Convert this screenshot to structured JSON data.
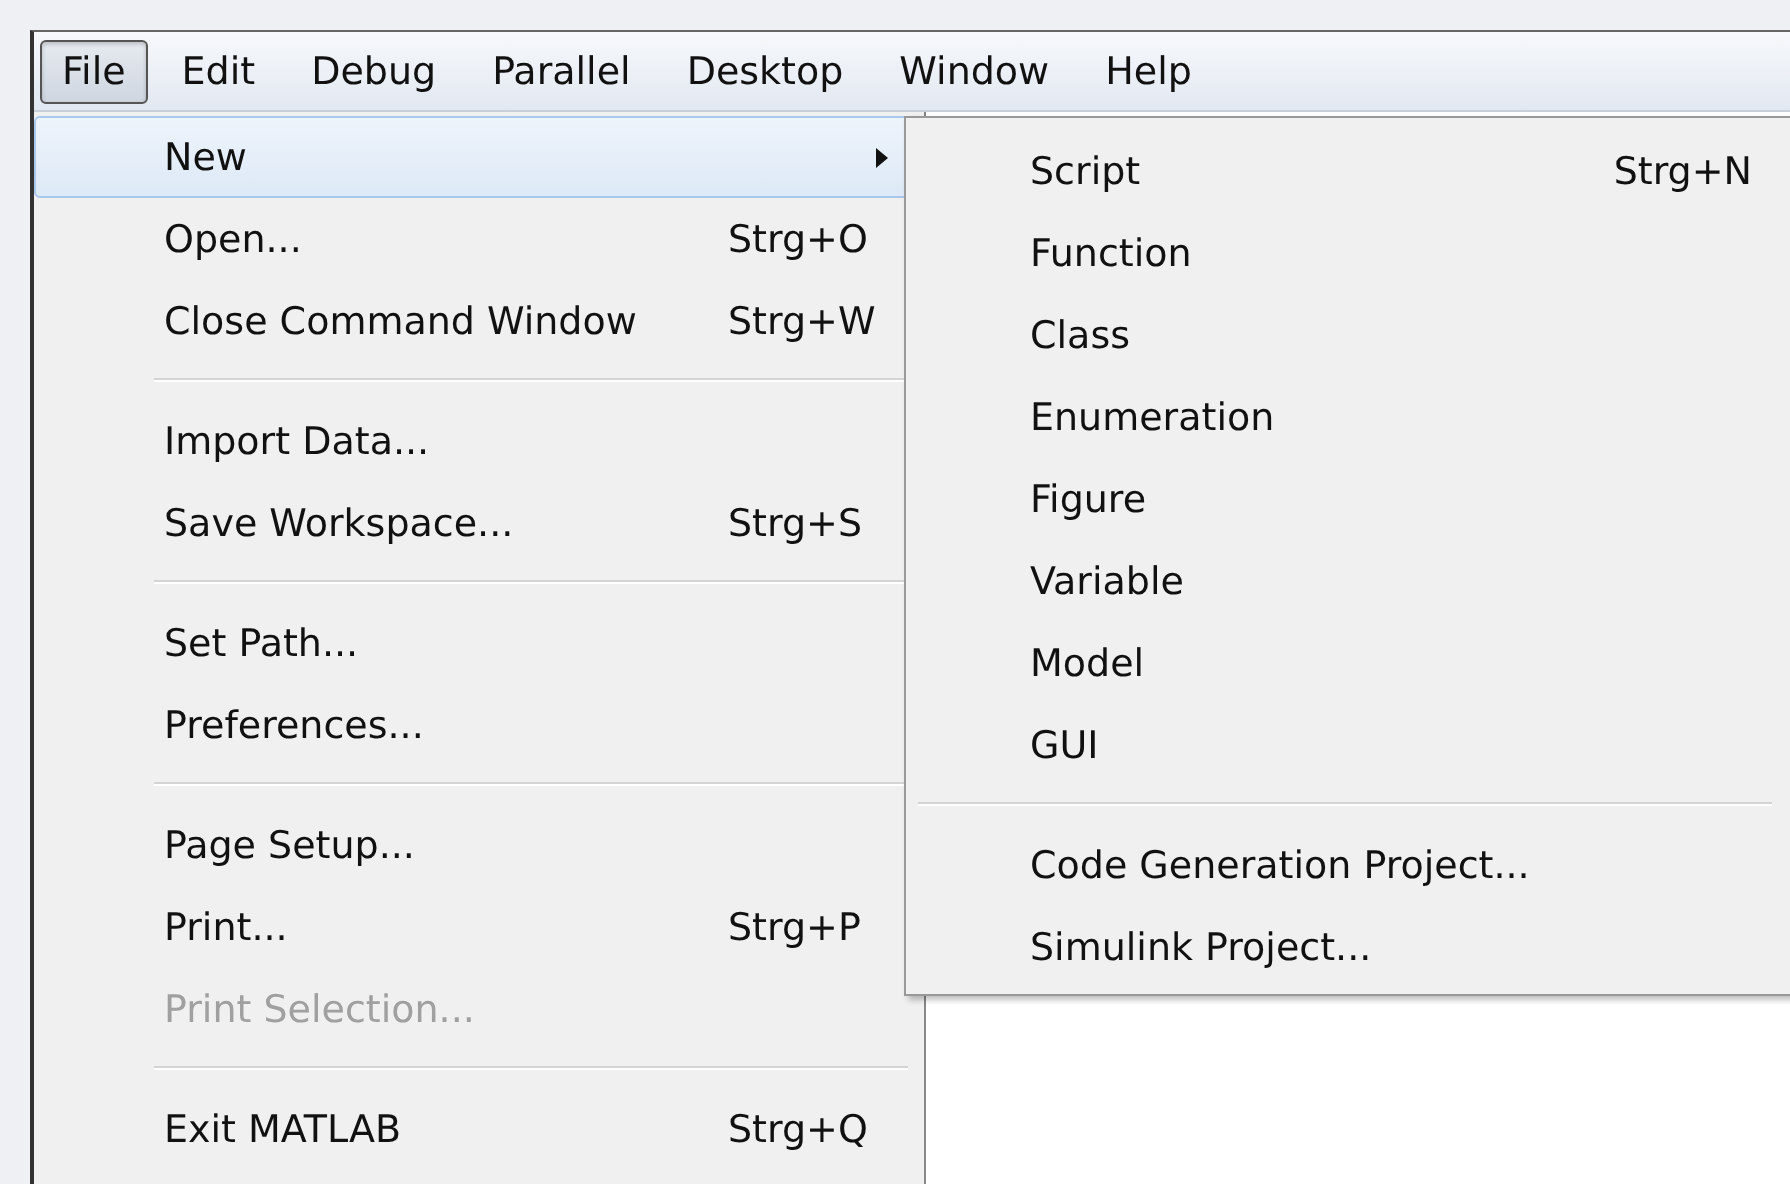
{
  "menu_bar": [
    {
      "label": "File",
      "selected": true
    },
    {
      "label": "Edit",
      "selected": false
    },
    {
      "label": "Debug",
      "selected": false
    },
    {
      "label": "Parallel",
      "selected": false
    },
    {
      "label": "Desktop",
      "selected": false
    },
    {
      "label": "Window",
      "selected": false
    },
    {
      "label": "Help",
      "selected": false
    }
  ],
  "file_menu": [
    {
      "kind": "item",
      "label": "New",
      "selected": true,
      "disabled": false,
      "submenu": true
    },
    {
      "kind": "item",
      "label": "Open...",
      "shortcut": "Strg+O",
      "selected": false,
      "disabled": false,
      "submenu": false
    },
    {
      "kind": "item",
      "label": "Close Command Window",
      "shortcut": "Strg+W",
      "selected": false,
      "disabled": false,
      "submenu": false
    },
    {
      "kind": "separator"
    },
    {
      "kind": "item",
      "label": "Import Data...",
      "selected": false,
      "disabled": false,
      "submenu": false
    },
    {
      "kind": "item",
      "label": "Save Workspace...",
      "shortcut": "Strg+S",
      "selected": false,
      "disabled": false,
      "submenu": false
    },
    {
      "kind": "separator"
    },
    {
      "kind": "item",
      "label": "Set Path...",
      "selected": false,
      "disabled": false,
      "submenu": false
    },
    {
      "kind": "item",
      "label": "Preferences...",
      "selected": false,
      "disabled": false,
      "submenu": false
    },
    {
      "kind": "separator"
    },
    {
      "kind": "item",
      "label": "Page Setup...",
      "selected": false,
      "disabled": false,
      "submenu": false
    },
    {
      "kind": "item",
      "label": "Print...",
      "shortcut": "Strg+P",
      "selected": false,
      "disabled": false,
      "submenu": false
    },
    {
      "kind": "item",
      "label": "Print Selection...",
      "selected": false,
      "disabled": true,
      "submenu": false
    },
    {
      "kind": "separator"
    },
    {
      "kind": "item",
      "label": "Exit MATLAB",
      "shortcut": "Strg+Q",
      "selected": false,
      "disabled": false,
      "submenu": false
    }
  ],
  "new_submenu": [
    {
      "kind": "item",
      "label": "Script",
      "shortcut": "Strg+N"
    },
    {
      "kind": "item",
      "label": "Function"
    },
    {
      "kind": "item",
      "label": "Class"
    },
    {
      "kind": "item",
      "label": "Enumeration"
    },
    {
      "kind": "item",
      "label": "Figure"
    },
    {
      "kind": "item",
      "label": "Variable"
    },
    {
      "kind": "item",
      "label": "Model"
    },
    {
      "kind": "item",
      "label": "GUI"
    },
    {
      "kind": "separator"
    },
    {
      "kind": "item",
      "label": "Code Generation Project..."
    },
    {
      "kind": "item",
      "label": "Simulink Project..."
    }
  ]
}
